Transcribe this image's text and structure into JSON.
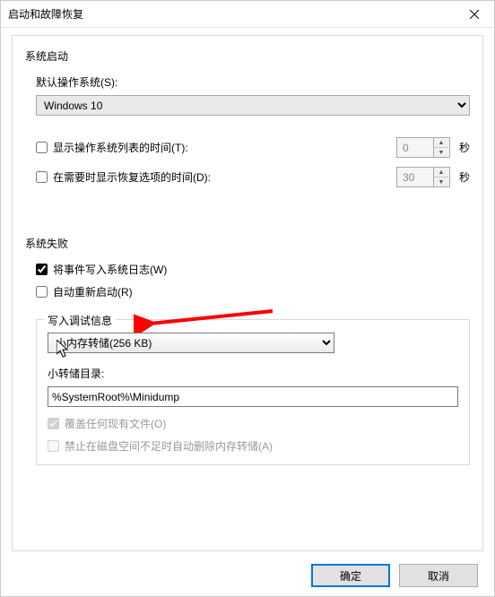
{
  "window": {
    "title": "启动和故障恢复"
  },
  "startup": {
    "group_label": "系统启动",
    "default_os_label": "默认操作系统(S):",
    "default_os_value": "Windows 10",
    "show_os_list_label": "显示操作系统列表的时间(T):",
    "show_os_list_checked": false,
    "show_os_list_seconds": "0",
    "show_recovery_label": "在需要时显示恢复选项的时间(D):",
    "show_recovery_checked": false,
    "show_recovery_seconds": "30",
    "seconds_unit": "秒"
  },
  "failure": {
    "group_label": "系统失败",
    "write_event_label": "将事件写入系统日志(W)",
    "write_event_checked": true,
    "auto_restart_label": "自动重新启动(R)",
    "auto_restart_checked": false,
    "debug_info_legend": "写入调试信息",
    "dump_type_value": "小内存转储(256 KB)",
    "dump_dir_label": "小转储目录:",
    "dump_dir_value": "%SystemRoot%\\Minidump",
    "overwrite_label": "覆盖任何现有文件(O)",
    "overwrite_checked": true,
    "overwrite_disabled": true,
    "no_dump_low_disk_label": "禁止在磁盘空间不足时自动删除内存转储(A)",
    "no_dump_low_disk_checked": false,
    "no_dump_low_disk_disabled": true
  },
  "buttons": {
    "ok": "确定",
    "cancel": "取消"
  }
}
